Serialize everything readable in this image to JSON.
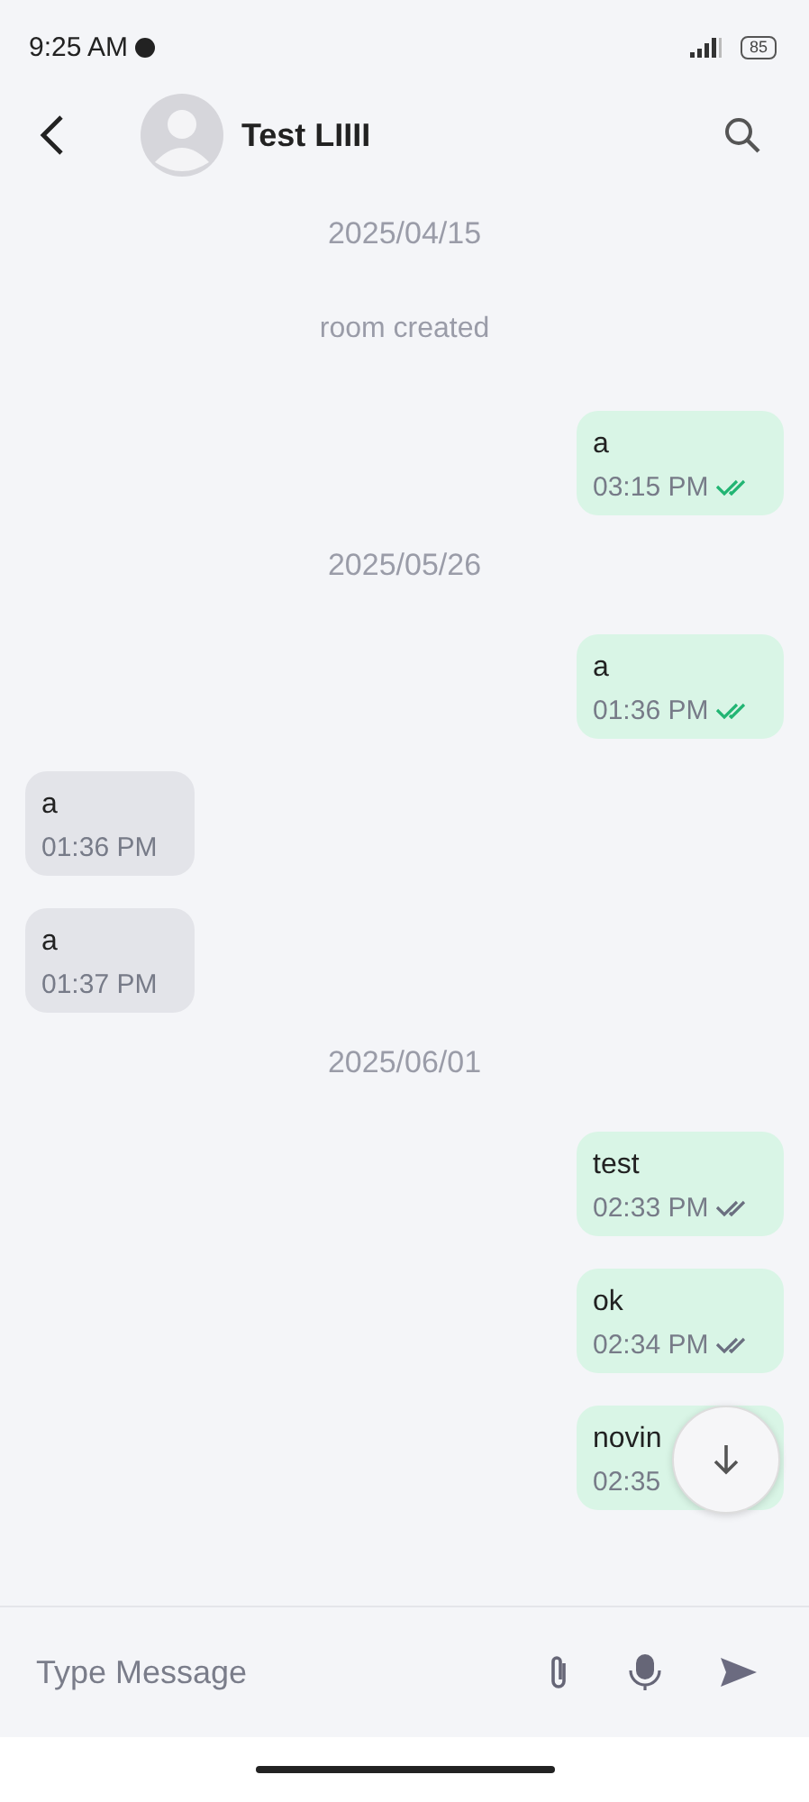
{
  "status_bar": {
    "time": "9:25 AM",
    "battery": "85"
  },
  "header": {
    "title": "Test LIIII"
  },
  "items": [
    {
      "kind": "date",
      "text": "2025/04/15"
    },
    {
      "kind": "notice",
      "text": "room created"
    },
    {
      "kind": "outgoing",
      "text": "a",
      "time": "03:15 PM",
      "read": true
    },
    {
      "kind": "date",
      "text": "2025/05/26"
    },
    {
      "kind": "outgoing",
      "text": "a",
      "time": "01:36 PM",
      "read": true
    },
    {
      "kind": "incoming",
      "text": "a",
      "time": "01:36 PM"
    },
    {
      "kind": "incoming",
      "text": "a",
      "time": "01:37 PM"
    },
    {
      "kind": "date",
      "text": "2025/06/01"
    },
    {
      "kind": "outgoing",
      "text": "test",
      "time": "02:33 PM",
      "read": false
    },
    {
      "kind": "outgoing",
      "text": "ok",
      "time": "02:34 PM",
      "read": false
    },
    {
      "kind": "outgoing",
      "text": "novin",
      "time": "02:35"
    }
  ],
  "composer": {
    "placeholder": "Type Message"
  }
}
